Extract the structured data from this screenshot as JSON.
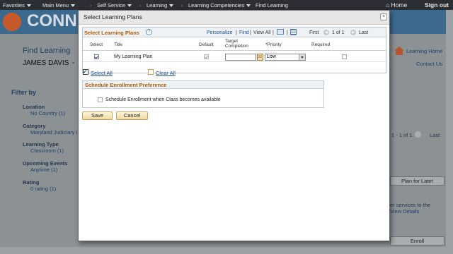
{
  "nav": {
    "favorites": "Favorites",
    "main_menu": "Main Menu",
    "breadcrumb": [
      "Self Service",
      "Learning",
      "Learning Competencies",
      "Find Learning"
    ],
    "home": "Home",
    "signout": "Sign out"
  },
  "background": {
    "logo": "CONN",
    "page_title": "Find Learning",
    "user": "JAMES DAVIS",
    "user_suffix": "-",
    "learning_home": "Learning Home",
    "contact_us": "Contact Us",
    "filter_by": "Filter by",
    "filters": [
      {
        "label": "Location",
        "value": "No Country (1)"
      },
      {
        "label": "Category",
        "value": "Maryland Judiciary L"
      },
      {
        "label": "Learning Type",
        "value": "Classroom (1)"
      },
      {
        "label": "Upcoming Events",
        "value": "Anytime (1)"
      },
      {
        "label": "Rating",
        "value": "0 rating (1)"
      }
    ],
    "pager": "1 - 1 of 1",
    "last": "Last",
    "plan_for_later": "Plan for Later",
    "services_text": "er services to the",
    "view_details": "View Details",
    "enroll": "Enroll"
  },
  "modal": {
    "title": "Select Learning Plans",
    "close": "×",
    "grid": {
      "title": "Select Learning Plans",
      "personalize": "Personalize",
      "find": "Find",
      "view_all": "View All",
      "first": "First",
      "pager": "1 of 1",
      "last": "Last",
      "columns": [
        "Select",
        "Title",
        "Default",
        "Target Completion",
        "*Priority",
        "Required"
      ],
      "row": {
        "title": "My Learning Plan",
        "target_completion": "",
        "priority": "Low"
      }
    },
    "select_all": "Select All",
    "clear_all": "Clear All",
    "schedule": {
      "header": "Schedule Enrollment Preference",
      "checkbox_label": "Schedule Enrollment when Class becomes available"
    },
    "save": "Save",
    "cancel": "Cancel"
  }
}
